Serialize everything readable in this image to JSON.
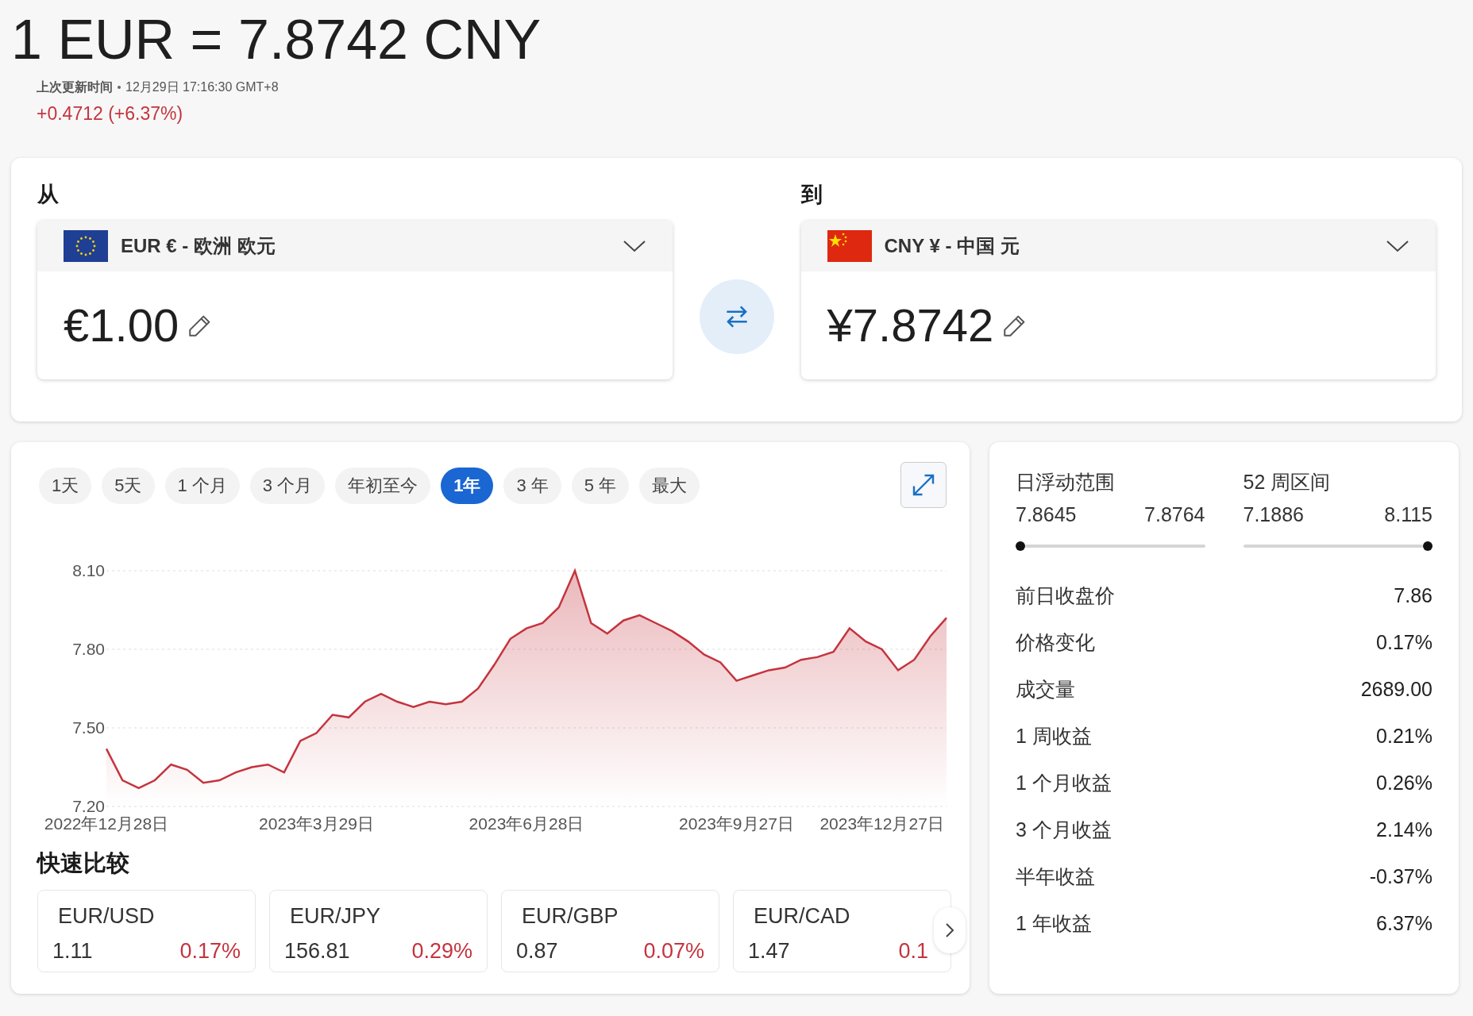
{
  "header": {
    "title": "1 EUR = 7.8742 CNY",
    "updated_label": "上次更新时间",
    "updated_time": "12月29日 17:16:30 GMT+8",
    "change": "+0.4712 (+6.37%)"
  },
  "converter": {
    "from": {
      "label": "从",
      "currency": "EUR € - 欧洲 欧元",
      "amount": "€1.00"
    },
    "to": {
      "label": "到",
      "currency": "CNY ¥ - 中国 元",
      "amount": "¥7.8742"
    }
  },
  "ranges": [
    {
      "label": "1天",
      "selected": false
    },
    {
      "label": "5天",
      "selected": false
    },
    {
      "label": "1 个月",
      "selected": false
    },
    {
      "label": "3 个月",
      "selected": false
    },
    {
      "label": "年初至今",
      "selected": false
    },
    {
      "label": "1年",
      "selected": true
    },
    {
      "label": "3 年",
      "selected": false
    },
    {
      "label": "5 年",
      "selected": false
    },
    {
      "label": "最大",
      "selected": false
    }
  ],
  "chart_data": {
    "type": "area",
    "categories": [
      "2022年12月28日",
      null,
      null,
      null,
      null,
      null,
      null,
      null,
      null,
      null,
      null,
      null,
      null,
      "2023年3月29日",
      null,
      null,
      null,
      null,
      null,
      null,
      null,
      null,
      null,
      null,
      null,
      null,
      "2023年6月28日",
      null,
      null,
      null,
      null,
      null,
      null,
      null,
      null,
      null,
      null,
      null,
      null,
      "2023年9月27日",
      null,
      null,
      null,
      null,
      null,
      null,
      null,
      null,
      "2023年12月27日",
      null,
      null,
      null,
      null
    ],
    "series": [
      {
        "color": "#c4343e",
        "values": [
          7.42,
          7.3,
          7.27,
          7.3,
          7.36,
          7.34,
          7.29,
          7.3,
          7.33,
          7.35,
          7.36,
          7.33,
          7.45,
          7.48,
          7.55,
          7.54,
          7.6,
          7.63,
          7.6,
          7.58,
          7.6,
          7.59,
          7.6,
          7.65,
          7.74,
          7.84,
          7.88,
          7.9,
          7.96,
          8.1,
          7.9,
          7.86,
          7.91,
          7.93,
          7.9,
          7.87,
          7.83,
          7.78,
          7.75,
          7.68,
          7.7,
          7.72,
          7.73,
          7.76,
          7.77,
          7.79,
          7.88,
          7.83,
          7.8,
          7.72,
          7.76,
          7.85,
          7.92
        ]
      }
    ],
    "ylim": [
      7.2,
      8.1
    ],
    "yticks": [
      {
        "value": 7.2,
        "label": "7.20"
      },
      {
        "value": 7.5,
        "label": "7.50"
      },
      {
        "value": 7.8,
        "label": "7.80"
      },
      {
        "value": 8.1,
        "label": "8.10"
      }
    ]
  },
  "quick_compare": {
    "title": "快速比较",
    "items": [
      {
        "pair": "EUR/USD",
        "rate": "1.11",
        "change": "0.17%"
      },
      {
        "pair": "EUR/JPY",
        "rate": "156.81",
        "change": "0.29%"
      },
      {
        "pair": "EUR/GBP",
        "rate": "0.87",
        "change": "0.07%"
      },
      {
        "pair": "EUR/CAD",
        "rate": "1.47",
        "change": "0.1"
      }
    ]
  },
  "stats": {
    "ranges": [
      {
        "label": "日浮动范围",
        "low": "7.8645",
        "high": "7.8764",
        "level": 0
      },
      {
        "label": "52 周区间",
        "low": "7.1886",
        "high": "8.115",
        "level": 1
      }
    ],
    "rows": [
      {
        "label": "前日收盘价",
        "value": "7.86"
      },
      {
        "label": "价格变化",
        "value": "0.17%"
      },
      {
        "label": "成交量",
        "value": "2689.00"
      },
      {
        "label": "1 周收益",
        "value": "0.21%"
      },
      {
        "label": "1 个月收益",
        "value": "0.26%"
      },
      {
        "label": "3 个月收益",
        "value": "2.14%"
      },
      {
        "label": "半年收益",
        "value": "-0.37%"
      },
      {
        "label": "1 年收益",
        "value": "6.37%"
      }
    ]
  }
}
